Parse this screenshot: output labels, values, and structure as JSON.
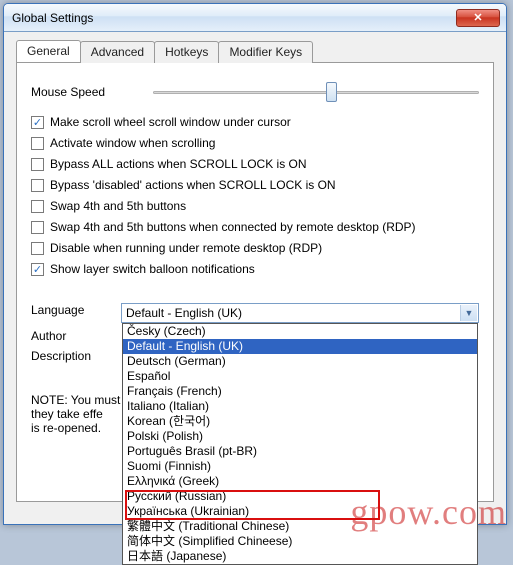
{
  "window": {
    "title": "Global Settings"
  },
  "titlebar": {
    "close_glyph": "✕"
  },
  "tabs": [
    {
      "label": "General",
      "active": true
    },
    {
      "label": "Advanced",
      "active": false
    },
    {
      "label": "Hotkeys",
      "active": false
    },
    {
      "label": "Modifier Keys",
      "active": false
    }
  ],
  "mouse_speed": {
    "label": "Mouse Speed"
  },
  "checks": [
    {
      "label": "Make scroll wheel scroll window under cursor",
      "checked": true
    },
    {
      "label": "Activate window when scrolling",
      "checked": false
    },
    {
      "label": "Bypass ALL actions when SCROLL LOCK is ON",
      "checked": false
    },
    {
      "label": "Bypass 'disabled' actions when SCROLL LOCK is ON",
      "checked": false
    },
    {
      "label": "Swap 4th and 5th buttons",
      "checked": false
    },
    {
      "label": "Swap 4th and 5th buttons when connected by remote desktop (RDP)",
      "checked": false
    },
    {
      "label": "Disable when running under remote desktop (RDP)",
      "checked": false
    },
    {
      "label": "Show layer switch balloon notifications",
      "checked": true
    }
  ],
  "language": {
    "label": "Language",
    "selected": "Default - English (UK)",
    "options": [
      "Česky (Czech)",
      "Default - English (UK)",
      "Deutsch (German)",
      "Español",
      "Français (French)",
      "Italiano (Italian)",
      "Korean (한국어)",
      "Polski (Polish)",
      "Português Brasil (pt-BR)",
      "Suomi (Finnish)",
      "Ελληνικά (Greek)",
      "Русский (Russian)",
      "Українська (Ukrainian)",
      "繁體中文 (Traditional Chinese)",
      "简体中文 (Simplified Chineese)",
      "日本語 (Japanese)"
    ],
    "selected_index": 1
  },
  "author": {
    "label": "Author"
  },
  "description": {
    "label": "Description"
  },
  "note": {
    "line1": "NOTE: You must",
    "line2": "they take effe",
    "line3": "is re-opened."
  },
  "watermark": "gpow.com"
}
